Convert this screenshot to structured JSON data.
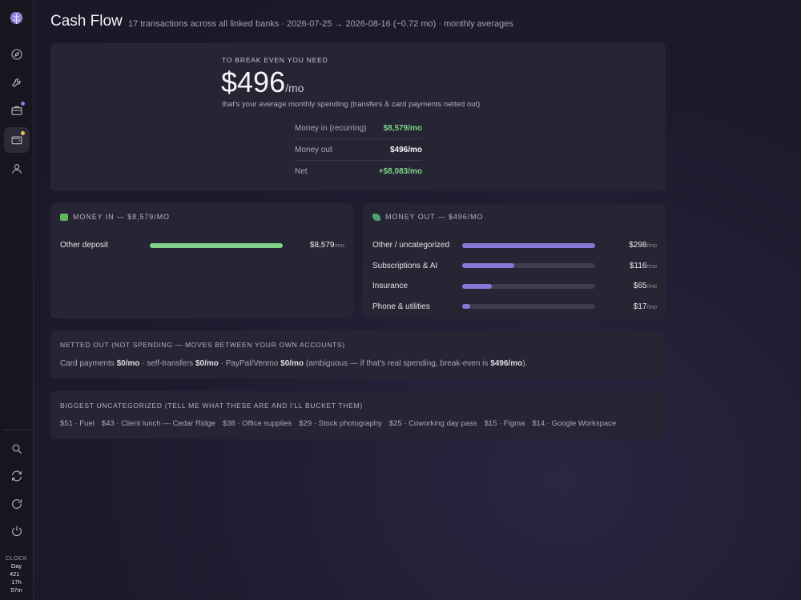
{
  "header": {
    "title": "Cash Flow",
    "subtitle": "17 transactions across all linked banks · 2026-07-25 → 2026-08-16 (~0.72 mo) · monthly averages"
  },
  "sidebar": {
    "icons": [
      "brain-logo-icon",
      "compass-icon",
      "wrench-icon",
      "briefcase-icon",
      "wallet-icon",
      "user-icon",
      "search-icon",
      "sync-icon",
      "refresh-icon",
      "power-icon"
    ],
    "clock": {
      "label": "CLOCK",
      "line1": "Day",
      "line2": "421 ·",
      "line3": "17h",
      "line4": "57m"
    },
    "accent_colors": {
      "notif_purple": "#8a7bf0",
      "notif_yellow": "#e6c45a"
    }
  },
  "breakeven": {
    "label": "TO BREAK EVEN YOU NEED",
    "amount": "$496",
    "unit": "/mo",
    "note": "that's your average monthly spending (transfers & card payments netted out)",
    "rows": [
      {
        "key": "Money in (recurring)",
        "value": "$8,579/mo",
        "tone": "green"
      },
      {
        "key": "Money out",
        "value": "$496/mo",
        "tone": "neutral"
      },
      {
        "key": "Net",
        "value": "+$8,083/mo",
        "tone": "green"
      }
    ]
  },
  "money_in": {
    "title": "MONEY IN — $8,579/MO",
    "bar_color": "#7fd38a",
    "items": [
      {
        "label": "Other deposit",
        "amount": "$8,579",
        "unit": "/mo",
        "fraction": 1.0
      }
    ]
  },
  "money_out": {
    "title": "MONEY OUT — $496/MO",
    "bar_color": "#8a76d6",
    "items": [
      {
        "label": "Other / uncategorized",
        "amount": "$298",
        "unit": "/mo",
        "fraction": 1.0
      },
      {
        "label": "Subscriptions & AI",
        "amount": "$116",
        "unit": "/mo",
        "fraction": 0.39
      },
      {
        "label": "Insurance",
        "amount": "$65",
        "unit": "/mo",
        "fraction": 0.22
      },
      {
        "label": "Phone & utilities",
        "amount": "$17",
        "unit": "/mo",
        "fraction": 0.06
      }
    ]
  },
  "netted": {
    "title": "NETTED OUT (NOT SPENDING — MOVES BETWEEN YOUR OWN ACCOUNTS)",
    "parts": [
      {
        "text": "Card payments ",
        "bold": false
      },
      {
        "text": "$0/mo",
        "bold": true
      },
      {
        "text": " · self-transfers ",
        "bold": false
      },
      {
        "text": "$0/mo",
        "bold": true
      },
      {
        "text": " · PayPal/Venmo ",
        "bold": false
      },
      {
        "text": "$0/mo",
        "bold": true
      },
      {
        "text": " (ambiguous — if that's real spending, break-even is ",
        "bold": false
      },
      {
        "text": "$496/mo",
        "bold": true
      },
      {
        "text": ").",
        "bold": false
      }
    ]
  },
  "uncategorized": {
    "title": "BIGGEST UNCATEGORIZED (TELL ME WHAT THESE ARE AND I'LL BUCKET THEM)",
    "items": [
      "$51 · Fuel",
      "$43 · Client lunch — Cedar Ridge",
      "$38 · Office supplies",
      "$29 · Stock photography",
      "$25 · Coworking day pass",
      "$15 · Figma",
      "$14 · Google Workspace"
    ]
  }
}
